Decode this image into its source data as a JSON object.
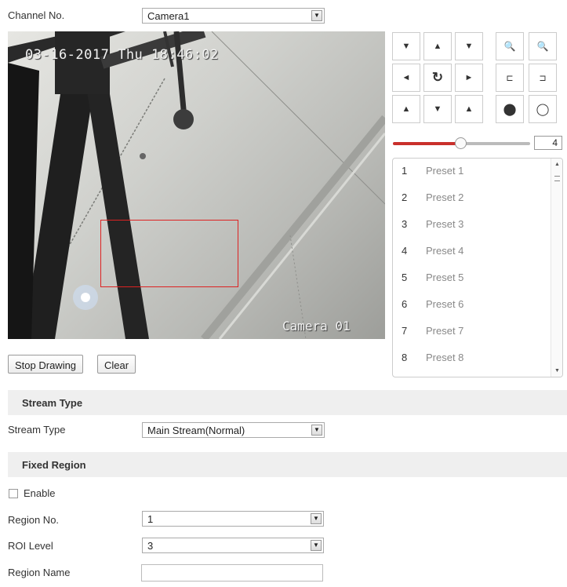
{
  "channel": {
    "label": "Channel No.",
    "value": "Camera1"
  },
  "video": {
    "osd_time": "03-16-2017 Thu 18:46:02",
    "osd_name": "Camera 01"
  },
  "ptz": {
    "speed": "4",
    "speed_fraction": 0.47,
    "buttons": {
      "up_left": "▼",
      "up": "▲",
      "up_right": "▼",
      "left": "◄",
      "auto": "↻",
      "right": "►",
      "down_left": "▲",
      "down": "▼",
      "down_right": "▲",
      "zoom_out": "🔍",
      "zoom_in": "🔍",
      "focus_near": "⊏",
      "focus_far": "⊐",
      "iris_open": "⬤",
      "iris_close": "◯"
    }
  },
  "presets": [
    {
      "num": "1",
      "name": "Preset 1"
    },
    {
      "num": "2",
      "name": "Preset 2"
    },
    {
      "num": "3",
      "name": "Preset 3"
    },
    {
      "num": "4",
      "name": "Preset 4"
    },
    {
      "num": "5",
      "name": "Preset 5"
    },
    {
      "num": "6",
      "name": "Preset 6"
    },
    {
      "num": "7",
      "name": "Preset 7"
    },
    {
      "num": "8",
      "name": "Preset 8"
    }
  ],
  "drawing": {
    "stop_label": "Stop Drawing",
    "clear_label": "Clear"
  },
  "stream_section": {
    "title": "Stream Type",
    "label": "Stream Type",
    "value": "Main Stream(Normal)"
  },
  "fixed_section": {
    "title": "Fixed Region",
    "enable_label": "Enable",
    "region_no_label": "Region No.",
    "region_no_value": "1",
    "roi_level_label": "ROI Level",
    "roi_level_value": "3",
    "region_name_label": "Region Name",
    "region_name_value": ""
  },
  "colors": {
    "accent_red": "#c9302c",
    "roi_rect": "#dd2222",
    "section_bg": "#efefef"
  }
}
